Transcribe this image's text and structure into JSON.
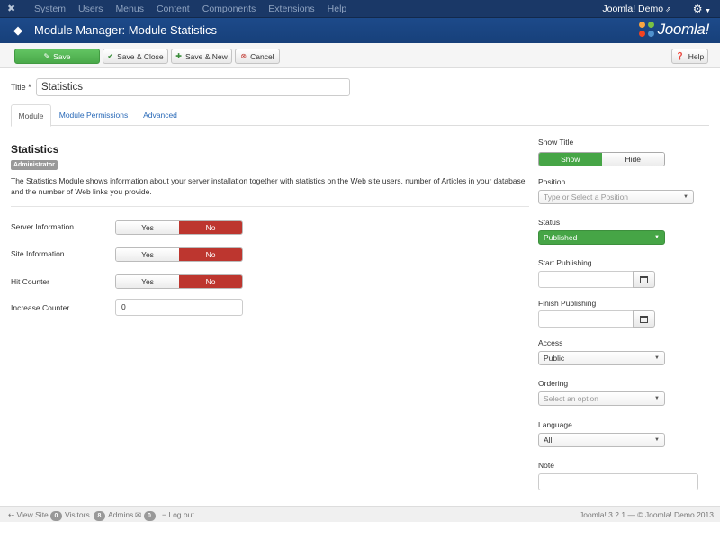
{
  "navbar": {
    "menu": [
      "System",
      "Users",
      "Menus",
      "Content",
      "Components",
      "Extensions",
      "Help"
    ],
    "user_label": "Joomla! Demo"
  },
  "header": {
    "title": "Module Manager: Module Statistics",
    "logo_text": "Joomla!"
  },
  "toolbar": {
    "save": "Save",
    "save_close": "Save & Close",
    "save_new": "Save & New",
    "cancel": "Cancel",
    "help": "Help"
  },
  "form": {
    "title_label": "Title *",
    "title_value": "Statistics"
  },
  "tabs": [
    "Module",
    "Module Permissions",
    "Advanced"
  ],
  "module": {
    "heading": "Statistics",
    "badge": "Administrator",
    "description": "The Statistics Module shows information about your server installation together with statistics on the Web site users, number of Articles in your database and the number of Web links you provide."
  },
  "options": {
    "server_information": "Server Information",
    "site_information": "Site Information",
    "hit_counter": "Hit Counter",
    "increase_counter": "Increase Counter",
    "increase_counter_value": "0",
    "yes": "Yes",
    "no": "No"
  },
  "sidebar": {
    "show_title_label": "Show Title",
    "show": "Show",
    "hide": "Hide",
    "position_label": "Position",
    "position_placeholder": "Type or Select a Position",
    "status_label": "Status",
    "status_value": "Published",
    "start_publishing_label": "Start Publishing",
    "finish_publishing_label": "Finish Publishing",
    "access_label": "Access",
    "access_value": "Public",
    "ordering_label": "Ordering",
    "ordering_placeholder": "Select an option",
    "language_label": "Language",
    "language_value": "All",
    "note_label": "Note"
  },
  "footer": {
    "view_site": "View Site",
    "visitors_count": "0",
    "visitors": "Visitors",
    "admins_count": "8",
    "admins": "Admins",
    "messages_count": "0",
    "logout": "Log out",
    "version": "Joomla! 3.2.1 — © Joomla! Demo 2013"
  },
  "colors": {
    "navbar": "#1a3867",
    "header": "#1d4a8a",
    "save_green": "#5bb75b",
    "no_red": "#bd362f",
    "published_green": "#46a546",
    "link_blue": "#2a6ab8"
  }
}
